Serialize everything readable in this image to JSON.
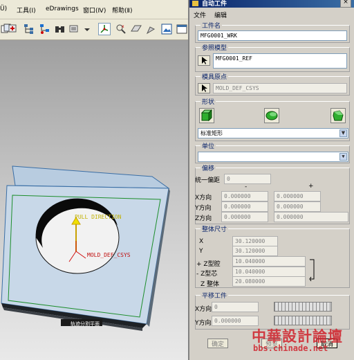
{
  "background_app": {
    "menu": [
      {
        "label": "Ü)"
      },
      {
        "label": "工具(Ⅰ)"
      },
      {
        "label": "eDrawings"
      },
      {
        "label": "窗口(Ⅳ)"
      },
      {
        "label": "帮助(Ⅱ)"
      }
    ],
    "model_labels": {
      "pull_direction": "PULL DIRECTION",
      "csys": "MOLD_DEF_CSYS",
      "bottom_caption": "轨迹分割平面"
    }
  },
  "dialog": {
    "title": "自动工件",
    "close_label": "×",
    "menu": [
      {
        "label": "文件"
      },
      {
        "label": "编辑"
      }
    ],
    "workpiece_name": {
      "group_title": "工件名",
      "value": "MFG0001_WRK"
    },
    "reference_model": {
      "group_title": "参照模型",
      "value": "MFG0001_REF"
    },
    "model_origin": {
      "group_title": "模具原点",
      "value": "MOLD_DEF_CSYS"
    },
    "shape": {
      "group_title": "形状",
      "selected": "标准矩形"
    },
    "units": {
      "group_title": "单位",
      "selected": ""
    },
    "offset": {
      "group_title": "偏移",
      "uniform_label": "统一偏距",
      "uniform_value": "0",
      "minus_header": "-",
      "plus_header": "+",
      "rows": [
        {
          "label": "X方向",
          "minus": "0.000000",
          "plus": "0.000000"
        },
        {
          "label": "Y方向",
          "minus": "0.000000",
          "plus": "0.000000"
        },
        {
          "label": "Z方向",
          "minus": "0.000000",
          "plus": "0.000000"
        }
      ]
    },
    "overall_size": {
      "group_title": "整体尺寸",
      "rows": [
        {
          "label": "X",
          "value": "30.120000"
        },
        {
          "label": "Y",
          "value": "30.120000"
        },
        {
          "label": "+ Z型腔",
          "value": "10.040000"
        },
        {
          "label": "- Z型芯",
          "value": "10.040000"
        },
        {
          "label": "Z 整体",
          "value": "20.080000"
        }
      ]
    },
    "translate": {
      "group_title": "平移工件",
      "rows": [
        {
          "label": "X方向",
          "value": "0"
        },
        {
          "label": "Y方向",
          "value": "0.000000"
        }
      ]
    },
    "buttons": {
      "ok": "确定",
      "preview": "预览",
      "cancel": "取消"
    }
  },
  "watermark": {
    "line1": "中華設計論壇",
    "line2": "bbs.chinade.net"
  },
  "colors": {
    "title_bar": "#0a246a",
    "group_title": "#0a246a",
    "shape_green": "#2fae2f",
    "model_face": "#c8d8e8",
    "watermark_red": "#d0202a"
  }
}
